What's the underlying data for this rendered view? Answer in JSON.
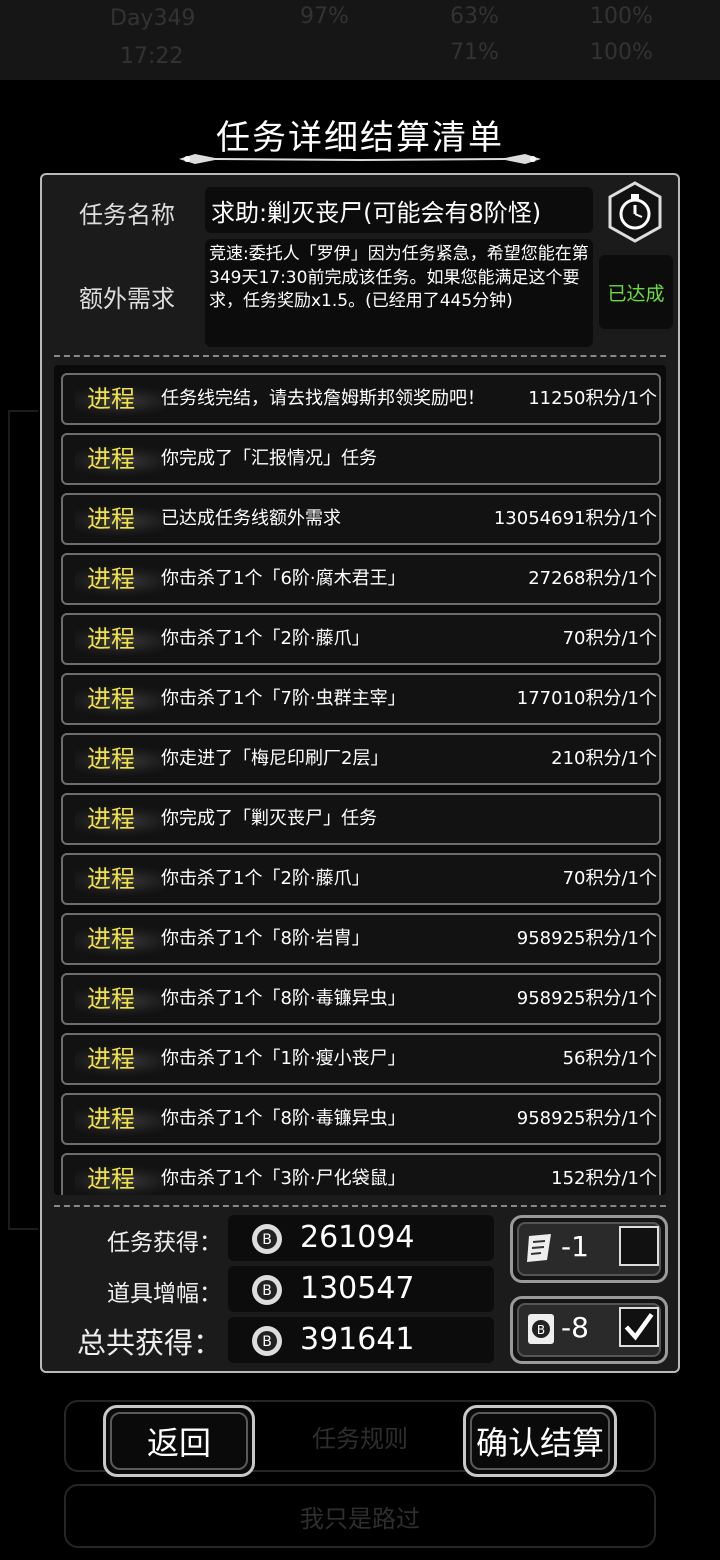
{
  "background": {
    "status": [
      "Day349",
      "17:22",
      "97%",
      "63%",
      "100%",
      "71%",
      "100%"
    ],
    "middle_button": "任务规则",
    "bottom_button": "我只是路过"
  },
  "dialog": {
    "title": "任务详细结算清单",
    "task_name_label": "任务名称",
    "task_name_value": "求助:剿灭丧尸(可能会有8阶怪)",
    "extra_label": "额外需求",
    "extra_text": "竞速:委托人「罗伊」因为任务紧急，希望您能在第349天17:30前完成该任务。如果您能满足这个要求，任务奖励x1.5。(已经用了445分钟)",
    "extra_status": "已达成",
    "progress": [
      {
        "tag": "进程",
        "text": "任务线完结，请去找詹姆斯邦领奖励吧！",
        "points": "11250积分/1个"
      },
      {
        "tag": "进程",
        "text": "你完成了「汇报情况」任务",
        "points": ""
      },
      {
        "tag": "进程",
        "text": "已达成任务线额外需求",
        "points": "13054691积分/1个"
      },
      {
        "tag": "进程",
        "text": "你击杀了1个「6阶·腐木君王」",
        "points": "27268积分/1个"
      },
      {
        "tag": "进程",
        "text": "你击杀了1个「2阶·藤爪」",
        "points": "70积分/1个"
      },
      {
        "tag": "进程",
        "text": "你击杀了1个「7阶·虫群主宰」",
        "points": "177010积分/1个"
      },
      {
        "tag": "进程",
        "text": "你走进了「梅尼印刷厂2层」",
        "points": "210积分/1个"
      },
      {
        "tag": "进程",
        "text": "你完成了「剿灭丧尸」任务",
        "points": ""
      },
      {
        "tag": "进程",
        "text": "你击杀了1个「2阶·藤爪」",
        "points": "70积分/1个"
      },
      {
        "tag": "进程",
        "text": "你击杀了1个「8阶·岩胄」",
        "points": "958925积分/1个"
      },
      {
        "tag": "进程",
        "text": "你击杀了1个「8阶·毒镰异虫」",
        "points": "958925积分/1个"
      },
      {
        "tag": "进程",
        "text": "你击杀了1个「1阶·瘦小丧尸」",
        "points": "56积分/1个"
      },
      {
        "tag": "进程",
        "text": "你击杀了1个「8阶·毒镰异虫」",
        "points": "958925积分/1个"
      },
      {
        "tag": "进程",
        "text": "你击杀了1个「3阶·尸化袋鼠」",
        "points": "152积分/1个"
      }
    ],
    "summary": {
      "task_label": "任务获得：",
      "task_value": "261094",
      "bonus_label": "道具增幅：",
      "bonus_value": "130547",
      "total_label": "总共获得：",
      "total_value": "391641"
    },
    "items": [
      {
        "icon": "scroll-icon",
        "count": "-1",
        "checked": false
      },
      {
        "icon": "coin-card-icon",
        "count": "-8",
        "checked": true
      }
    ],
    "back_button": "返回",
    "confirm_button": "确认结算"
  }
}
